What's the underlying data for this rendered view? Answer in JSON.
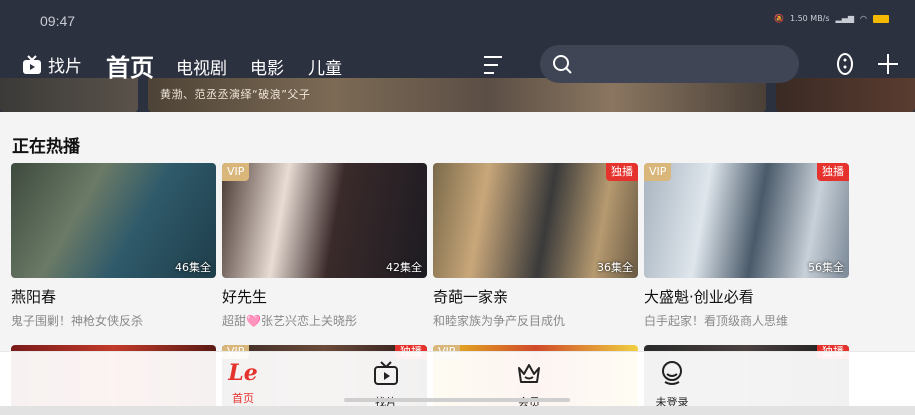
{
  "status": {
    "time": "09:47",
    "speed": "1.50 MB/s"
  },
  "nav": {
    "find_film": "找片",
    "tabs": [
      "首页",
      "电视剧",
      "电影",
      "儿童"
    ],
    "search_placeholder": ""
  },
  "banner": {
    "caption": "黄渤、范丞丞演绎“破浪”父子"
  },
  "section": {
    "title": "正在热播"
  },
  "cards": [
    {
      "title": "燕阳春",
      "subtitle": "鬼子围剿！神枪女侠反杀",
      "episodes": "46集全",
      "badge_vip": "",
      "badge_excl": ""
    },
    {
      "title": "好先生",
      "subtitle": "超甜🩷张艺兴恋上关晓彤",
      "episodes": "42集全",
      "badge_vip": "VIP",
      "badge_excl": ""
    },
    {
      "title": "奇葩一家亲",
      "subtitle": "和睦家族为争产反目成仇",
      "episodes": "36集全",
      "badge_vip": "",
      "badge_excl": "独播"
    },
    {
      "title": "大盛魁·创业必看",
      "subtitle": "白手起家！看顶级商人思维",
      "episodes": "56集全",
      "badge_vip": "VIP",
      "badge_excl": "独播"
    }
  ],
  "row2_badges": [
    {
      "vip": "",
      "excl": ""
    },
    {
      "vip": "VIP",
      "excl": "独播"
    },
    {
      "vip": "VIP",
      "excl": ""
    },
    {
      "vip": "",
      "excl": "独播"
    }
  ],
  "tabbar": {
    "home_logo": "Le",
    "home": "首页",
    "find": "找片",
    "member": "会员",
    "login": "未登录"
  },
  "colors": {
    "accent": "#e5322d",
    "header": "#2c3140",
    "vip": "#d9b67a"
  }
}
